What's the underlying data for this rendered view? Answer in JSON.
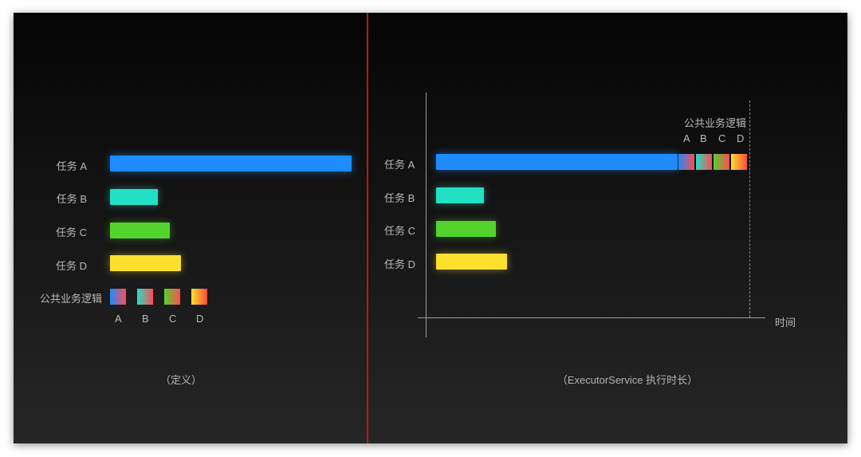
{
  "left": {
    "tasks": [
      {
        "label": "任务 A",
        "duration": 302,
        "color": "#1e8cff"
      },
      {
        "label": "任务 B",
        "duration": 60,
        "color": "#22e0c4"
      },
      {
        "label": "任务 C",
        "duration": 75,
        "color": "#52d42c"
      },
      {
        "label": "任务 D",
        "duration": 89,
        "color": "#fbe02e"
      }
    ],
    "shared_label": "公共业务逻辑",
    "shared_parts": [
      "A",
      "B",
      "C",
      "D"
    ],
    "caption": "（定义）"
  },
  "right": {
    "tasks": [
      {
        "label": "任务 A",
        "duration": 302
      },
      {
        "label": "任务 B",
        "duration": 60
      },
      {
        "label": "任务 C",
        "duration": 75
      },
      {
        "label": "任务 D",
        "duration": 89
      }
    ],
    "shared_label": "公共业务逻辑",
    "shared_parts": [
      "A",
      "B",
      "C",
      "D"
    ],
    "axis_label": "时间",
    "caption": "（ExecutorService 执行时长）"
  }
}
